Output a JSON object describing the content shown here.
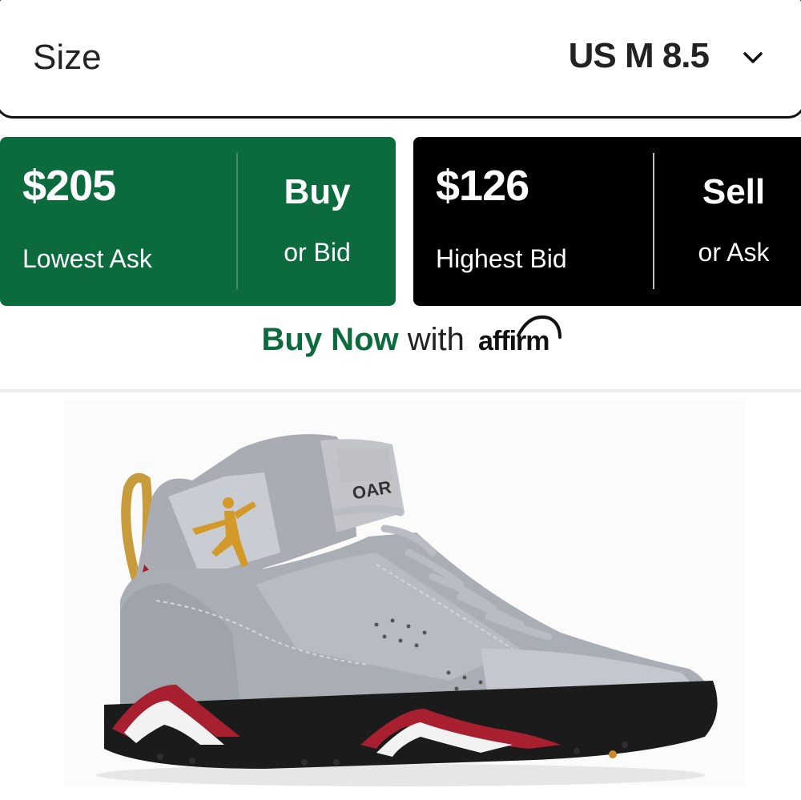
{
  "size": {
    "label": "Size",
    "value": "US M 8.5",
    "chevron_icon": "chevron-down-icon"
  },
  "ask": {
    "price": "$205",
    "caption": "Lowest Ask",
    "cta": "Buy",
    "cta_sub": "or Bid",
    "color": "#0b6b3c"
  },
  "bid": {
    "price": "$126",
    "caption": "Highest Bid",
    "cta": "Sell",
    "cta_sub": "or Ask",
    "color": "#000000"
  },
  "financing": {
    "buy_now": "Buy Now",
    "with": "with",
    "brand": "affirm"
  },
  "product": {
    "image": "sneaker-product-image",
    "tongue_text": "OAR"
  }
}
